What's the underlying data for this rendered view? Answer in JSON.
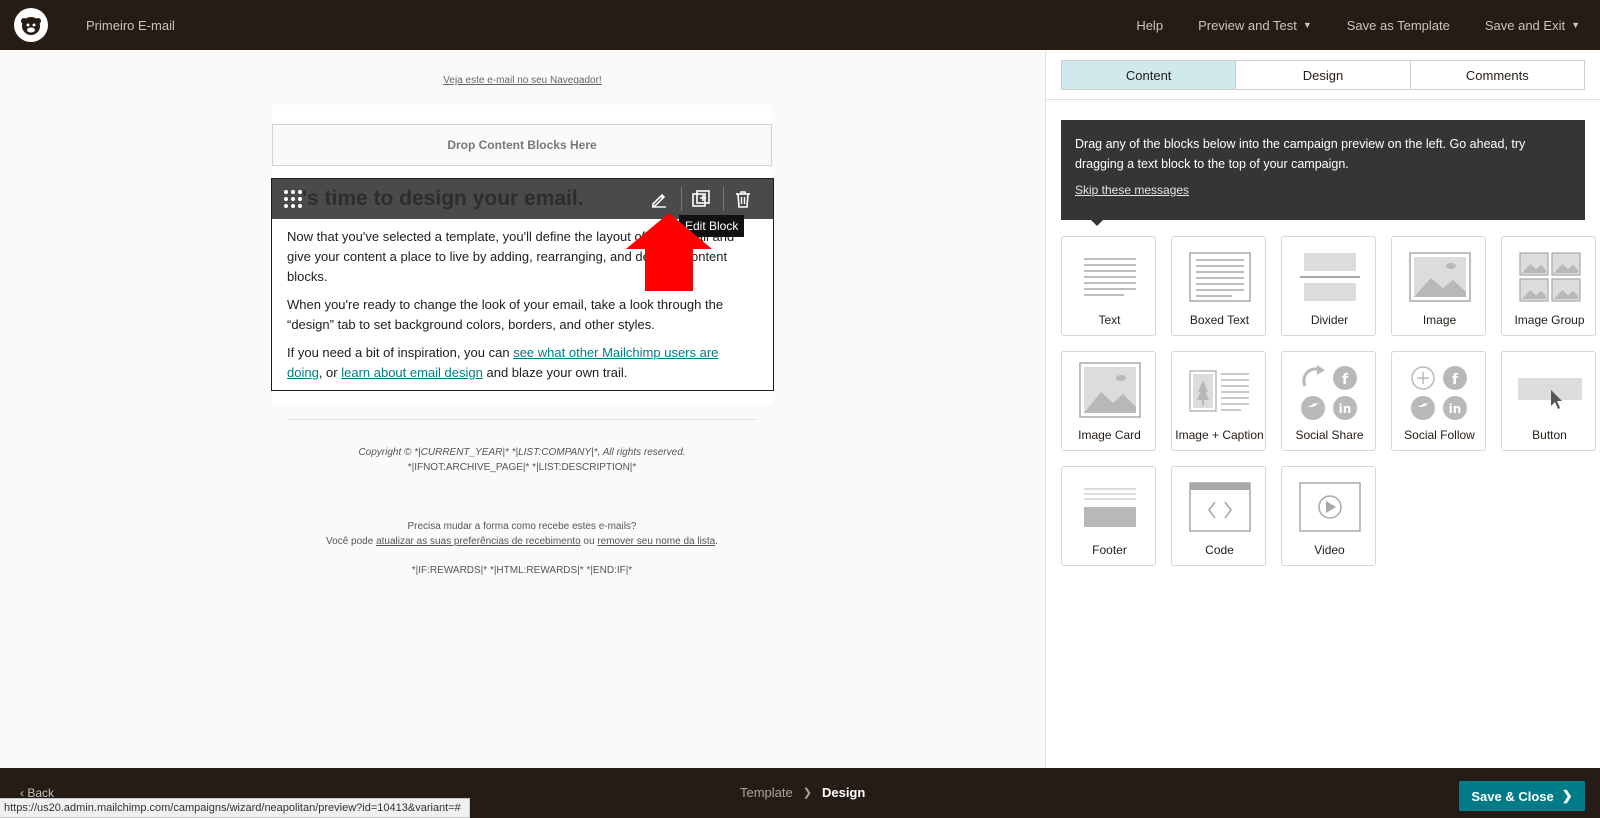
{
  "header": {
    "campaign_name": "Primeiro E-mail",
    "nav": {
      "help": "Help",
      "preview_test": "Preview and Test",
      "save_template": "Save as Template",
      "save_exit": "Save and Exit"
    }
  },
  "preview": {
    "view_in_browser": "Veja este e-mail no seu Navegador!",
    "drop_zone": "Drop Content Blocks Here",
    "text_block": {
      "heading": "'s time to design your email.",
      "p1": "Now that you've selected a template, you'll define the layout of your email and give your content a place to live by adding, rearranging, and deleting content blocks.",
      "p2": "When you're ready to change the look of your email, take a look through the “design” tab to set background colors, borders, and other styles.",
      "p3_before": "If you need a bit of inspiration, you can ",
      "p3_link1": "see what other Mailchimp users are doing",
      "p3_mid": ", or ",
      "p3_link2": "learn about email design",
      "p3_after": " and blaze your own trail.",
      "tooltip": "Edit Block"
    },
    "footer": {
      "copyright": "Copyright © *|CURRENT_YEAR|* *|LIST:COMPANY|*, All rights reserved.",
      "archive": "*|IFNOT:ARCHIVE_PAGE|* *|LIST:DESCRIPTION|*",
      "change_q": "Precisa mudar a forma como recebe estes e-mails?",
      "can_prefix": "Você pode ",
      "prefs_link": "atualizar as suas preferências de recebimento",
      "or": " ou ",
      "remove_link": "remover seu nome da lista",
      "period": ".",
      "rewards": "*|IF:REWARDS|* *|HTML:REWARDS|* *|END:IF|*"
    }
  },
  "sidepanel": {
    "tabs": [
      "Content",
      "Design",
      "Comments"
    ],
    "active_tab": "Content",
    "help_text": "Drag any of the blocks below into the campaign preview on the left. Go ahead, try dragging a text block to the top of your campaign.",
    "skip_link": "Skip these messages",
    "blocks": [
      {
        "label": "Text",
        "icon": "text-block-icon"
      },
      {
        "label": "Boxed Text",
        "icon": "boxed-text-block-icon"
      },
      {
        "label": "Divider",
        "icon": "divider-block-icon"
      },
      {
        "label": "Image",
        "icon": "image-block-icon"
      },
      {
        "label": "Image Group",
        "icon": "image-group-block-icon"
      },
      {
        "label": "Image Card",
        "icon": "image-card-block-icon"
      },
      {
        "label": "Image + Caption",
        "icon": "image-caption-block-icon"
      },
      {
        "label": "Social Share",
        "icon": "social-share-block-icon"
      },
      {
        "label": "Social Follow",
        "icon": "social-follow-block-icon"
      },
      {
        "label": "Button",
        "icon": "button-block-icon"
      },
      {
        "label": "Footer",
        "icon": "footer-block-icon"
      },
      {
        "label": "Code",
        "icon": "code-block-icon"
      },
      {
        "label": "Video",
        "icon": "video-block-icon"
      }
    ]
  },
  "bottombar": {
    "back": "Back",
    "breadcrumb_template": "Template",
    "breadcrumb_current": "Design",
    "save_close": "Save & Close"
  },
  "status_url": "https://us20.admin.mailchimp.com/campaigns/wizard/neapolitan/preview?id=10413&variant=#",
  "colors": {
    "topbar": "#241c15",
    "accent": "#007c89",
    "active_tab": "#cfe9ec",
    "arrow": "#ff0000"
  }
}
